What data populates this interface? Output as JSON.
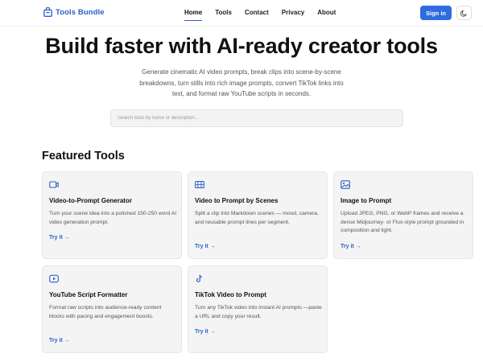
{
  "brand": {
    "name": "Tools Bundle",
    "icon": "bag-icon",
    "color": "#2b5fc7"
  },
  "nav": {
    "links": [
      {
        "label": "Home",
        "active": true
      },
      {
        "label": "Tools"
      },
      {
        "label": "Contact"
      },
      {
        "label": "Privacy"
      },
      {
        "label": "About"
      }
    ],
    "signin_label": "Sign in",
    "theme_icon": "moon-icon"
  },
  "hero": {
    "title": "Build faster with AI-ready creator tools",
    "subtitle": "Generate cinematic AI video prompts, break clips into scene-by-scene breakdowns, turn stills into rich image prompts, convert TikTok links into text, and format raw YouTube scripts in seconds."
  },
  "search": {
    "placeholder": "Search tools by name or description..."
  },
  "featured": {
    "title": "Featured Tools",
    "link_label": "Try it →",
    "cards": [
      {
        "icon": "video-camera-icon",
        "title": "Video-to-Prompt Generator",
        "description": "Turn your scene idea into a polished 150-250 word AI video generation prompt."
      },
      {
        "icon": "film-strip-icon",
        "title": "Video to Prompt by Scenes",
        "description": "Split a clip into Markdown scenes — mood, camera, and reusable prompt lines per segment."
      },
      {
        "icon": "image-icon",
        "title": "Image to Prompt",
        "description": "Upload JPEG, PNG, or WebP frames and receive a dense Midjourney- or Flux-style prompt grounded in composition and light."
      },
      {
        "icon": "play-icon",
        "title": "YouTube Script Formatter",
        "description": "Format raw scripts into audience-ready content blocks with pacing and engagement boosts."
      },
      {
        "icon": "tiktok-icon",
        "title": "TikTok Video to Prompt",
        "description": "Turn any TikTok video into instant AI prompts —paste a URL and copy your result."
      }
    ]
  }
}
